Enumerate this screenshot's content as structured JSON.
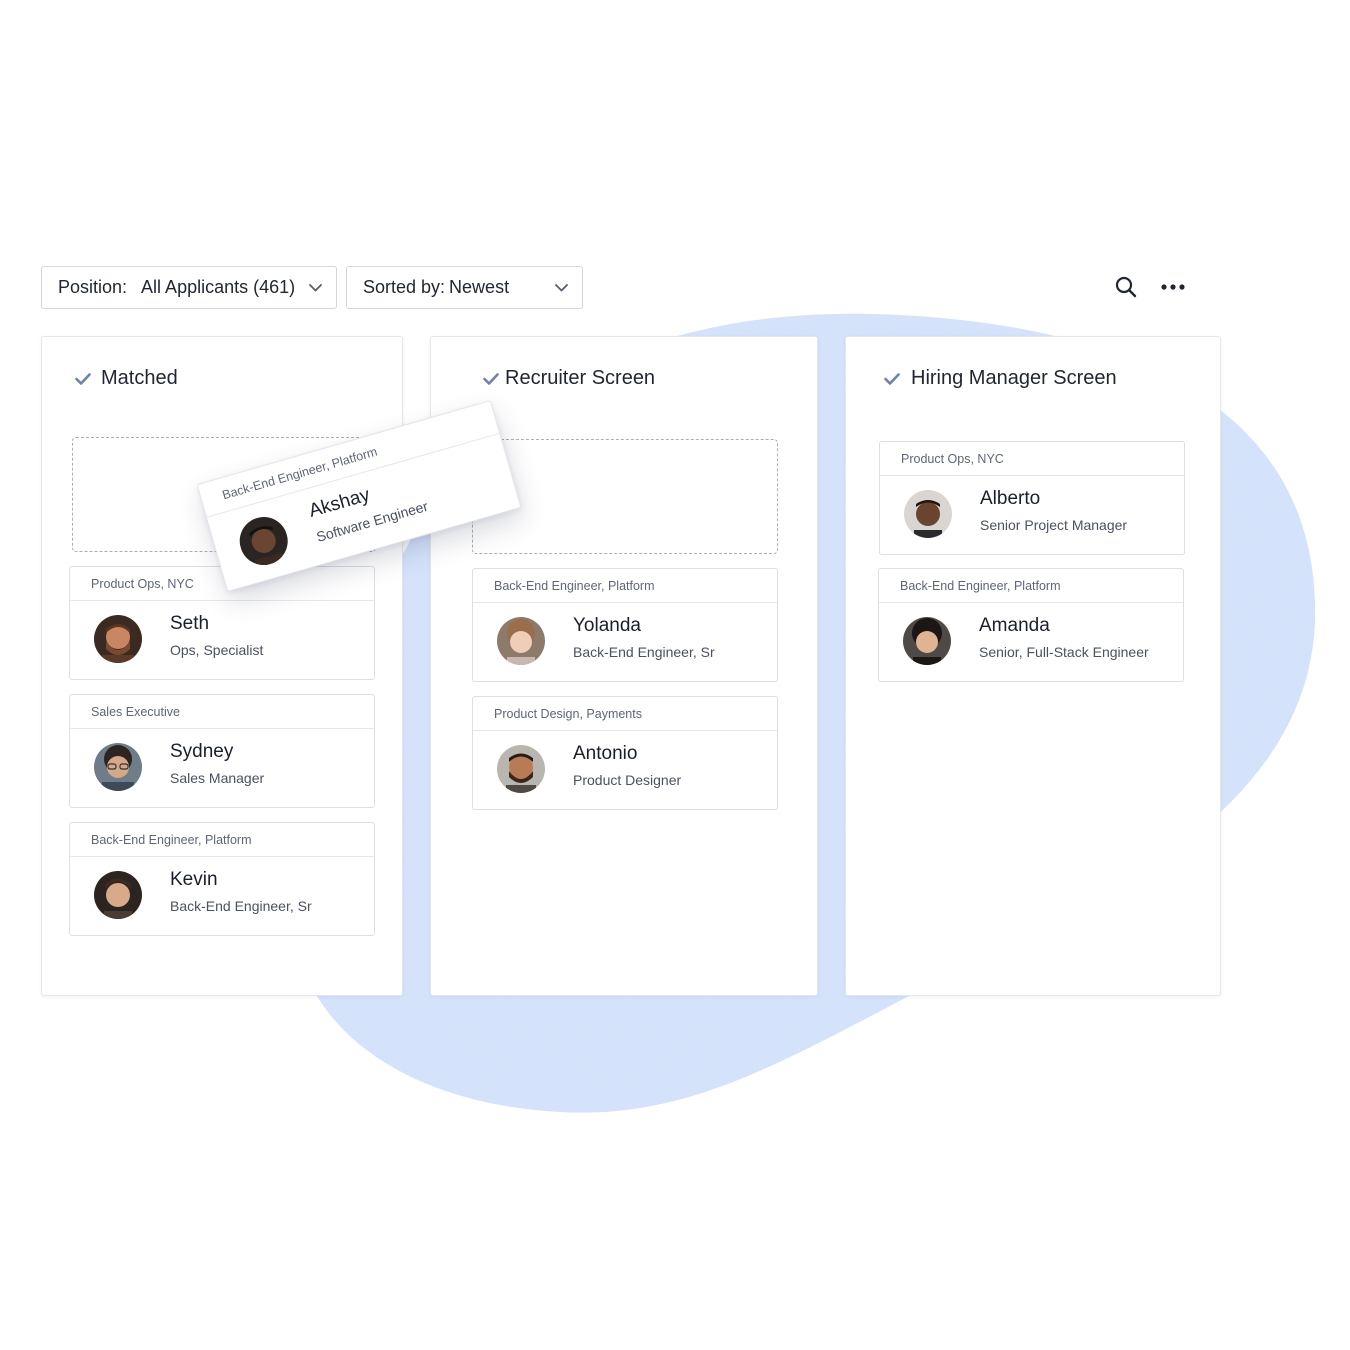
{
  "toolbar": {
    "position_label": "Position:",
    "position_value": "All Applicants (461)",
    "sort_label": "Sorted by:",
    "sort_value": "Newest",
    "search_icon": "search-icon",
    "more_icon": "more-horizontal-icon"
  },
  "colors": {
    "accent_blob": "#d6e4fb",
    "check": "#6d84a8",
    "border": "#dcdfe5",
    "dashed": "#a9aebb"
  },
  "columns": [
    {
      "title": "Matched",
      "cards": [
        {
          "position": "Product Ops, NYC",
          "name": "Seth",
          "role": "Ops, Specialist"
        },
        {
          "position": "Sales Executive",
          "name": "Sydney",
          "role": "Sales Manager"
        },
        {
          "position": "Back-End Engineer, Platform",
          "name": "Kevin",
          "role": "Back-End Engineer, Sr"
        }
      ]
    },
    {
      "title": "Recruiter Screen",
      "cards": [
        {
          "position": "Back-End Engineer, Platform",
          "name": "Yolanda",
          "role": "Back-End Engineer, Sr"
        },
        {
          "position": "Product Design, Payments",
          "name": "Antonio",
          "role": "Product Designer"
        }
      ]
    },
    {
      "title": "Hiring Manager Screen",
      "cards": [
        {
          "position": "Product Ops, NYC",
          "name": "Alberto",
          "role": "Senior Project Manager"
        },
        {
          "position": "Back-End Engineer, Platform",
          "name": "Amanda",
          "role": "Senior, Full-Stack Engineer"
        }
      ]
    }
  ],
  "dragging_card": {
    "position": "Back-End Engineer, Platform",
    "name": "Akshay",
    "role": "Software Engineer"
  }
}
